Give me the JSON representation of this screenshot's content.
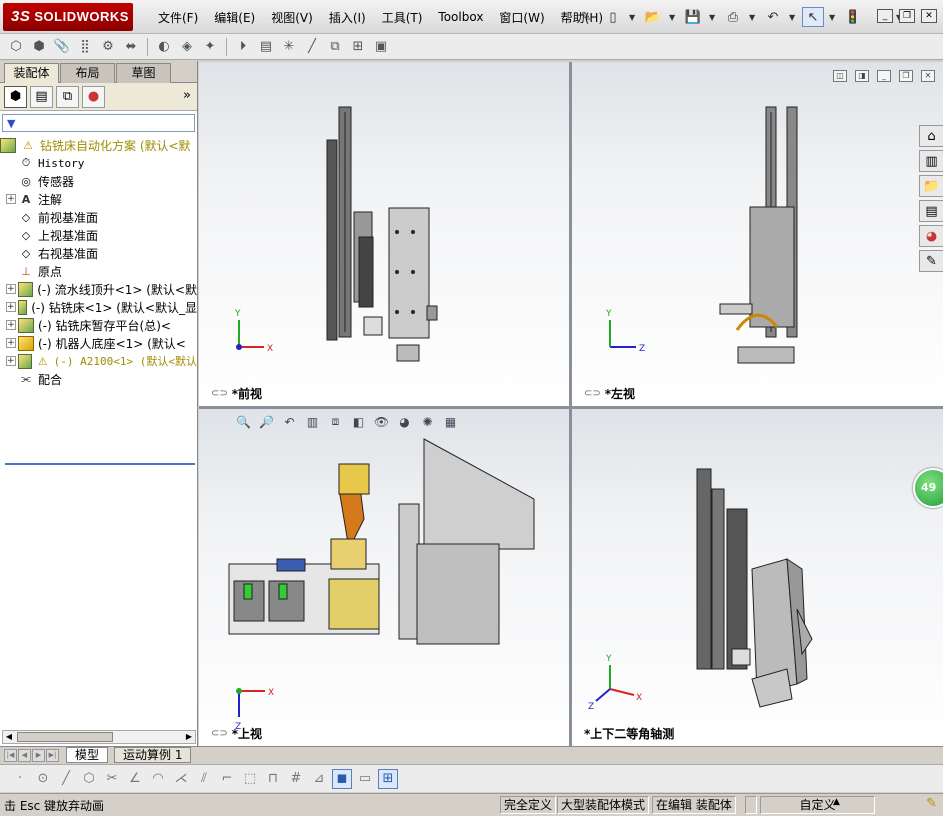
{
  "app": {
    "logo_prefix": "3S",
    "logo_text": "SOLIDWORKS"
  },
  "menu": [
    "文件(F)",
    "编辑(E)",
    "视图(V)",
    "插入(I)",
    "工具(T)",
    "Toolbox",
    "窗口(W)",
    "帮助(H)"
  ],
  "panel_tabs": [
    "装配体",
    "布局",
    "草图"
  ],
  "filter_symbol": "▼",
  "tree": {
    "root": "钻铣床自动化方案 (默认<默",
    "items": [
      {
        "label": "History"
      },
      {
        "label": "传感器"
      },
      {
        "label": "注解"
      },
      {
        "label": "前视基准面"
      },
      {
        "label": "上视基准面"
      },
      {
        "label": "右视基准面"
      },
      {
        "label": "原点"
      },
      {
        "label": "(-) 流水线顶升<1> (默认<默"
      },
      {
        "label": "(-) 钻铣床<1> (默认<默认_显"
      },
      {
        "label": "(-) 钻铣床暂存平台(总)<"
      },
      {
        "label": "(-) 机器人底座<1> (默认<"
      },
      {
        "label": "(-) A2100<1> (默认<默认"
      },
      {
        "label": "配合"
      }
    ]
  },
  "viewports": {
    "front": "*前视",
    "left": "*左视",
    "top": "*上视",
    "iso": "*上下二等角轴测"
  },
  "axes": {
    "x": "X",
    "y": "Y",
    "z": "Z"
  },
  "task_badge": "49",
  "bottom_tabs": [
    "模型",
    "运动算例 1"
  ],
  "status": {
    "message": "击 Esc 键放弃动画",
    "fully_defined": "完全定义",
    "large_assembly": "大型装配体模式",
    "editing": "在编辑 装配体",
    "custom": "自定义"
  }
}
